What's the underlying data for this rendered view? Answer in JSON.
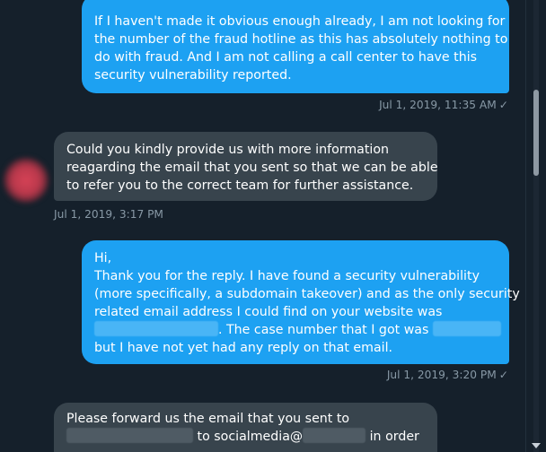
{
  "messages": [
    {
      "lines": [
        "If I haven't made it obvious enough already, I am not looking for",
        "the number of the fraud hotline as this has absolutely nothing to",
        "do with fraud. And I am not calling a call center to have this",
        "security vulnerability reported."
      ],
      "timestamp": "Jul 1, 2019, 11:35 AM"
    },
    {
      "lines": [
        "Could you kindly provide us with more information",
        "reagarding the email that you sent so that we can be able",
        "to refer you to the correct team for further assistance."
      ],
      "timestamp": "Jul 1, 2019, 3:17 PM"
    },
    {
      "lines": [
        "Hi,",
        "Thank you for the reply. I have found a security vulnerability",
        "(more specifically, a subdomain takeover) and as the only security",
        "related email address I could find on your website was"
      ],
      "line5_text": ". The case number that I got was",
      "line6": "but I have not yet had any reply on that email.",
      "timestamp": "Jul 1, 2019, 3:20 PM"
    },
    {
      "line1": "Please forward us the email that you sent to",
      "line2_mid": "to socialmedia@",
      "line2_end": " in order"
    }
  ],
  "read_receipt_icon": "check-icon",
  "colors": {
    "background": "#15202b",
    "sent_bubble": "#1da1f2",
    "received_bubble": "#38444d",
    "timestamp": "#8899a6"
  }
}
